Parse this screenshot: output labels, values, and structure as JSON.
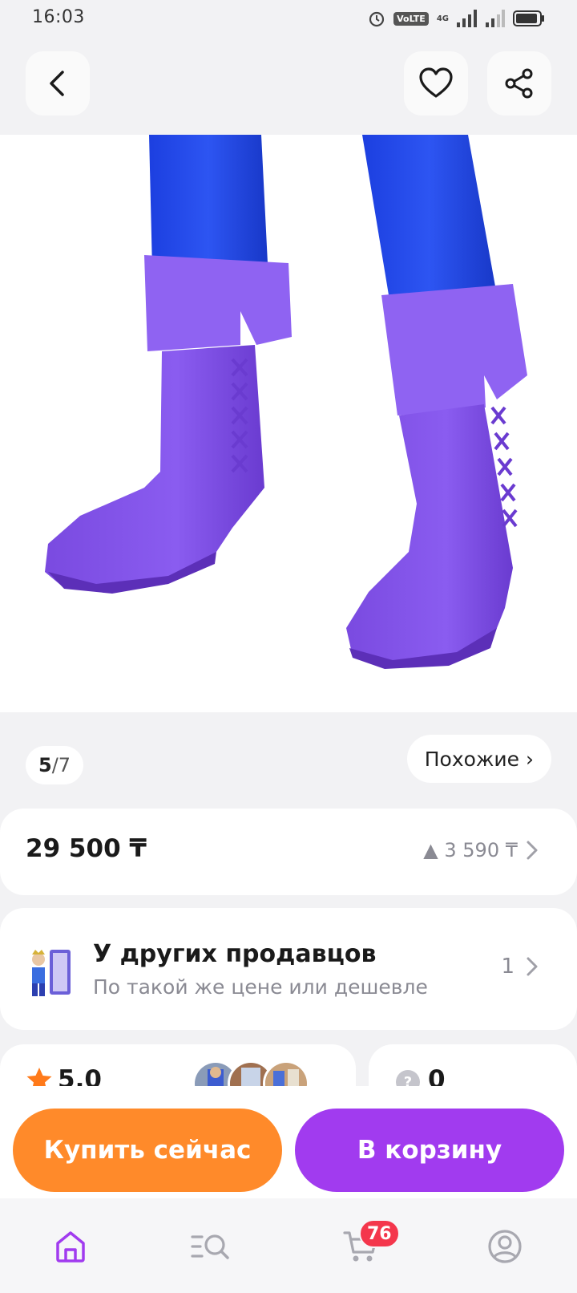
{
  "status_bar": {
    "time": "16:03",
    "volte_label": "VoLTE",
    "network_label": "4G"
  },
  "header": {
    "back_icon": "chevron-left-icon",
    "favorite_icon": "heart-icon",
    "share_icon": "share-icon"
  },
  "gallery": {
    "current": "5",
    "separator": "/",
    "total": "7",
    "similar_label": "Похожие ›"
  },
  "price": {
    "value": "29 500 ₸",
    "diff": "▲ 3 590 ₸"
  },
  "other_sellers": {
    "title": "У других продавцов",
    "subtitle": "По такой же цене или дешевле",
    "count": "1"
  },
  "reviews": {
    "rating": "5.0",
    "questions": "0"
  },
  "actions": {
    "buy_now": "Купить сейчас",
    "add_to_cart": "В корзину"
  },
  "bottom_nav": {
    "cart_badge": "76",
    "active": "home"
  },
  "colors": {
    "accent_purple": "#a13bef",
    "accent_orange": "#ff8a2a",
    "badge_red": "#f4364c"
  }
}
